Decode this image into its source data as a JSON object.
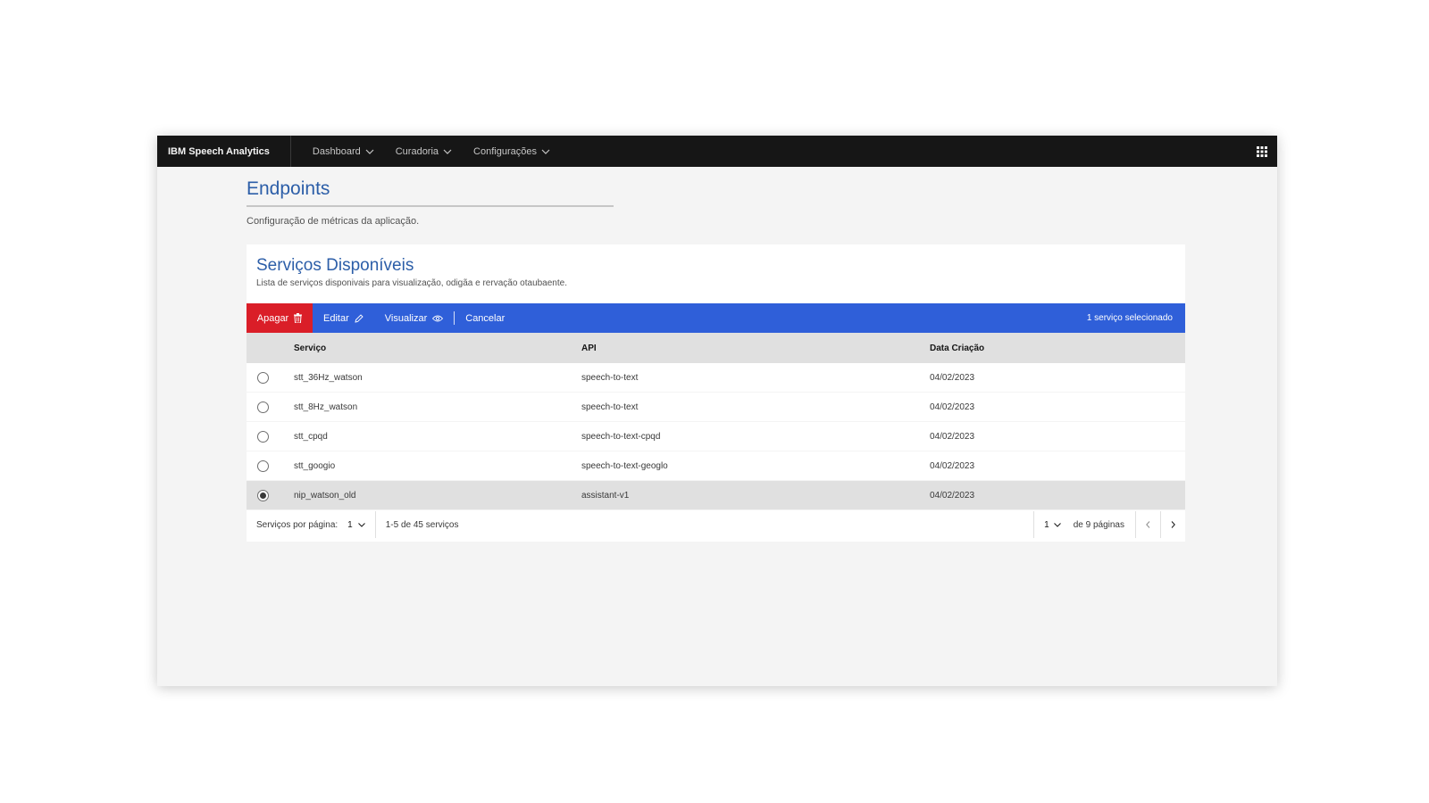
{
  "header": {
    "brand": "IBM Speech Analytics",
    "nav": [
      {
        "label": "Dashboard"
      },
      {
        "label": "Curadoria"
      },
      {
        "label": "Configurações"
      }
    ]
  },
  "page": {
    "title": "Endpoints",
    "description": "Configuração de métricas da aplicação."
  },
  "card": {
    "title": "Serviços Disponíveis",
    "subtitle": "Lista de serviços disponivais para visualização, odigãa e rervação otaubaente."
  },
  "actions": {
    "delete_label": "Apagar",
    "edit_label": "Editar",
    "view_label": "Visualizar",
    "cancel_label": "Cancelar",
    "selected_text": "1 serviço selecionado"
  },
  "table": {
    "headers": {
      "servico": "Serviço",
      "api": "API",
      "data": "Data Criação"
    },
    "rows": [
      {
        "servico": "stt_36Hz_watson",
        "api": "speech-to-text",
        "data": "04/02/2023",
        "selected": false
      },
      {
        "servico": "stt_8Hz_watson",
        "api": "speech-to-text",
        "data": "04/02/2023",
        "selected": false
      },
      {
        "servico": "stt_cpqd",
        "api": "speech-to-text-cpqd",
        "data": "04/02/2023",
        "selected": false
      },
      {
        "servico": "stt_googio",
        "api": "speech-to-text-geoglo",
        "data": "04/02/2023",
        "selected": false
      },
      {
        "servico": "nip_watson_old",
        "api": "assistant-v1",
        "data": "04/02/2023",
        "selected": true
      }
    ]
  },
  "pagination": {
    "per_page_label": "Serviços por página:",
    "per_page_value": "1",
    "range_text": "1-5 de 45 serviços",
    "current_page": "1",
    "total_pages_text": "de 9 páginas"
  },
  "colors": {
    "topbar": "#161616",
    "action_bar": "#2f5fd9",
    "delete": "#da1e28",
    "title": "#2c5ea8"
  },
  "icons": [
    "chevron-down-icon",
    "app-switcher-icon",
    "trash-icon",
    "edit-icon",
    "eye-icon",
    "chevron-left-icon",
    "chevron-right-icon"
  ]
}
